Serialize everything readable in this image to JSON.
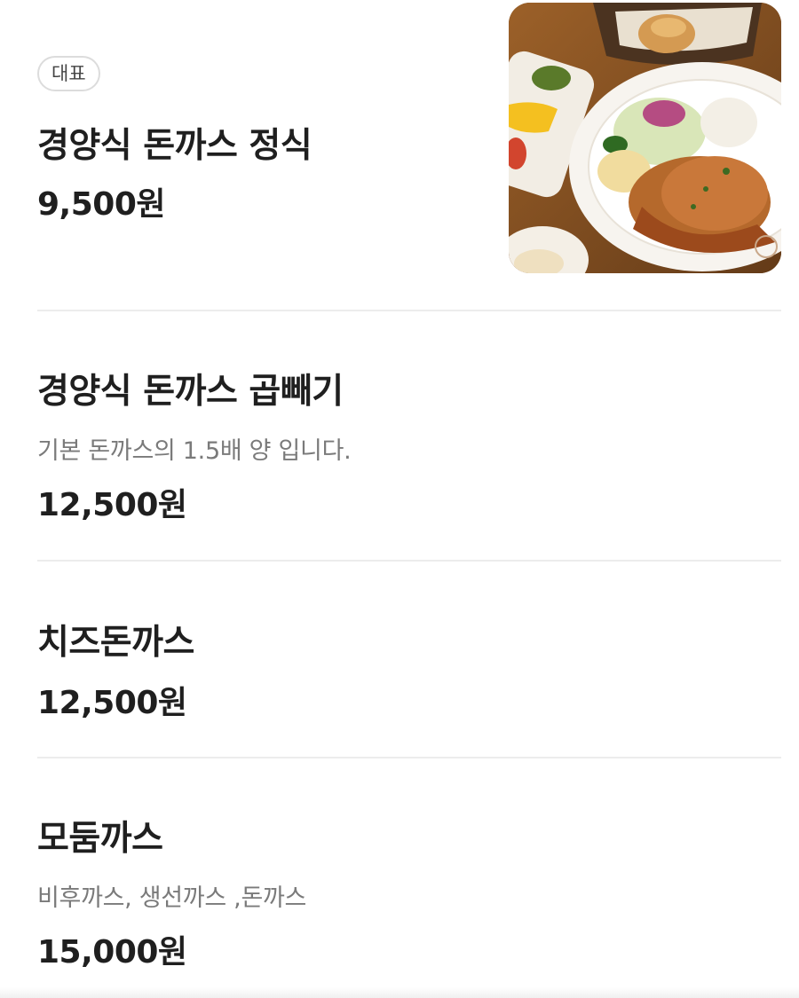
{
  "menu": {
    "items": [
      {
        "badge": "대표",
        "name": "경양식 돈까스 정식",
        "price": "9,500원",
        "photo_icon": "pork-cutlet-plate-photo"
      },
      {
        "name": "경양식 돈까스 곱빼기",
        "description": "기본 돈까스의 1.5배 양 입니다.",
        "price": "12,500원"
      },
      {
        "name": "치즈돈까스",
        "price": "12,500원"
      },
      {
        "name": "모둠까스",
        "description": "비후까스, 생선까스 ,돈까스",
        "price": "15,000원"
      }
    ]
  },
  "colors": {
    "text": "#1f1f1f",
    "muted": "#7a7a7a",
    "divider": "#ececec",
    "badge_border": "#dcdcdc"
  }
}
